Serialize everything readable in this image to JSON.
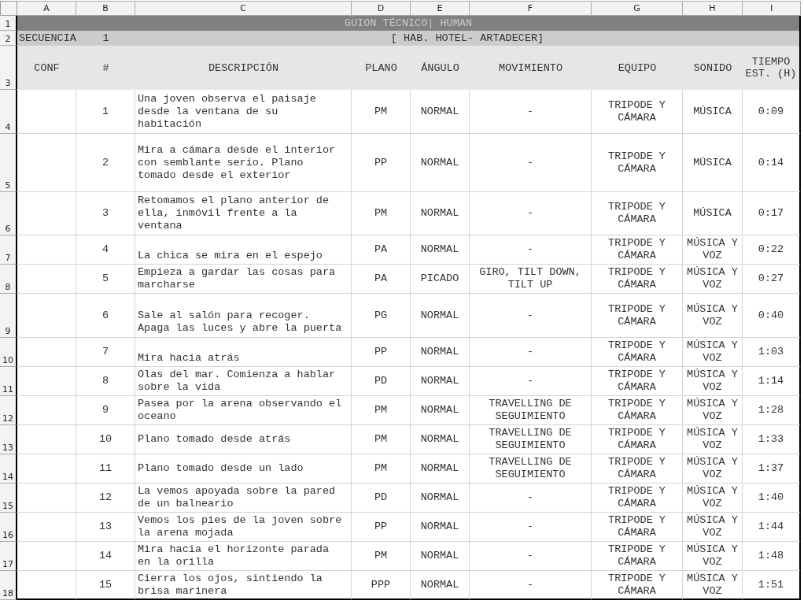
{
  "column_headers": [
    "A",
    "B",
    "C",
    "D",
    "E",
    "F",
    "G",
    "H",
    "I"
  ],
  "row_numbers": [
    "1",
    "2",
    "3",
    "4",
    "5",
    "6",
    "7",
    "8",
    "9",
    "10",
    "11",
    "12",
    "13",
    "14",
    "15",
    "16",
    "17",
    "18"
  ],
  "title": "GUION TÉCNICO| HUMAN",
  "sequence": {
    "label": "SECUENCIA",
    "number": "1",
    "location": "[ HAB. HOTEL- ARTADECER]"
  },
  "headers": [
    "CONF",
    "#",
    "DESCRIPCIÓN",
    "PLANO",
    "ÁNGULO",
    "MOVIMIENTO",
    "EQUIPO",
    "SONIDO",
    "TIEMPO EST. (H)"
  ],
  "shots": [
    {
      "number": "1",
      "description": "Una joven observa el paisaje desde la ventana de su habitación",
      "plano": "PM",
      "angulo": "NORMAL",
      "movimiento": "-",
      "equipo": "TRIPODE Y CÁMARA",
      "sonido": "MÚSICA",
      "tiempo": "0:09"
    },
    {
      "number": "2",
      "description": "Mira a cámara desde el interior con semblante serio. Plano tomado desde el exterior",
      "plano": "PP",
      "angulo": "NORMAL",
      "movimiento": "-",
      "equipo": "TRIPODE Y CÁMARA",
      "sonido": "MÚSICA",
      "tiempo": "0:14"
    },
    {
      "number": "3",
      "description": "Retomamos el plano anterior de ella, inmóvil frente a la ventana",
      "plano": "PM",
      "angulo": "NORMAL",
      "movimiento": "-",
      "equipo": "TRIPODE Y CÁMARA",
      "sonido": "MÚSICA",
      "tiempo": "0:17"
    },
    {
      "number": "4",
      "description": "\nLa chica se mira en el espejo",
      "plano": "PA",
      "angulo": "NORMAL",
      "movimiento": "-",
      "equipo": "TRIPODE Y CÁMARA",
      "sonido": "MÚSICA Y VOZ",
      "tiempo": "0:22"
    },
    {
      "number": "5",
      "description": "Empieza a gardar las cosas para marcharse",
      "plano": "PA",
      "angulo": "PICADO",
      "movimiento": "GIRO, TILT DOWN, TILT UP",
      "equipo": "TRIPODE Y CÁMARA",
      "sonido": "MÚSICA Y VOZ",
      "tiempo": "0:27"
    },
    {
      "number": "6",
      "description": "\nSale al salón para recoger.\nApaga las luces y abre la puerta",
      "plano": "PG",
      "angulo": "NORMAL",
      "movimiento": "-",
      "equipo": "TRIPODE Y CÁMARA",
      "sonido": "MÚSICA Y VOZ",
      "tiempo": "0:40"
    },
    {
      "number": "7",
      "description": "\nMira hacia atrás",
      "plano": "PP",
      "angulo": "NORMAL",
      "movimiento": "-",
      "equipo": "TRIPODE Y CÁMARA",
      "sonido": "MÚSICA Y VOZ",
      "tiempo": "1:03"
    },
    {
      "number": "8",
      "description": "Olas del mar. Comienza a hablar sobre la vida",
      "plano": "PD",
      "angulo": "NORMAL",
      "movimiento": "-",
      "equipo": "TRIPODE Y CÁMARA",
      "sonido": "MÚSICA Y VOZ",
      "tiempo": "1:14"
    },
    {
      "number": "9",
      "description": "Pasea por la arena observando el oceano",
      "plano": "PM",
      "angulo": "NORMAL",
      "movimiento": "TRAVELLING DE SEGUIMIENTO",
      "equipo": "TRIPODE Y CÁMARA",
      "sonido": "MÚSICA Y VOZ",
      "tiempo": "1:28"
    },
    {
      "number": "10",
      "description": "Plano tomado desde atrás",
      "plano": "PM",
      "angulo": "NORMAL",
      "movimiento": "TRAVELLING DE SEGUIMIENTO",
      "equipo": "TRIPODE Y CÁMARA",
      "sonido": "MÚSICA Y VOZ",
      "tiempo": "1:33"
    },
    {
      "number": "11",
      "description": "Plano tomado desde un lado",
      "plano": "PM",
      "angulo": "NORMAL",
      "movimiento": "TRAVELLING DE SEGUIMIENTO",
      "equipo": "TRIPODE Y CÁMARA",
      "sonido": "MÚSICA Y VOZ",
      "tiempo": "1:37"
    },
    {
      "number": "12",
      "description": "La vemos apoyada sobre la pared de un balneario",
      "plano": "PD",
      "angulo": "NORMAL",
      "movimiento": "-",
      "equipo": "TRIPODE Y CÁMARA",
      "sonido": "MÚSICA Y VOZ",
      "tiempo": "1:40"
    },
    {
      "number": "13",
      "description": "Vemos los pies de la joven sobre la arena mojada",
      "plano": "PP",
      "angulo": "NORMAL",
      "movimiento": "-",
      "equipo": "TRIPODE Y CÁMARA",
      "sonido": "MÚSICA Y VOZ",
      "tiempo": "1:44"
    },
    {
      "number": "14",
      "description": "Mira hacia el horizonte parada en la orilla",
      "plano": "PM",
      "angulo": "NORMAL",
      "movimiento": "-",
      "equipo": "TRIPODE Y CÁMARA",
      "sonido": "MÚSICA Y VOZ",
      "tiempo": "1:48"
    },
    {
      "number": "15",
      "description": "Cierra los ojos, sintiendo la brisa marinera",
      "plano": "PPP",
      "angulo": "NORMAL",
      "movimiento": "-",
      "equipo": "TRIPODE Y CÁMARA",
      "sonido": "MÚSICA Y VOZ",
      "tiempo": "1:51"
    }
  ]
}
